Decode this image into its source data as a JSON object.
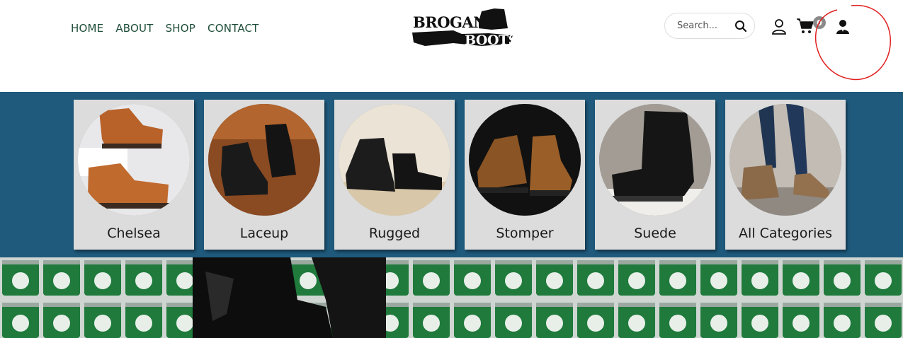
{
  "nav": {
    "items": [
      {
        "label": "HOME"
      },
      {
        "label": "ABOUT"
      },
      {
        "label": "SHOP"
      },
      {
        "label": "CONTACT"
      }
    ]
  },
  "logo": {
    "line1": "BROGAN",
    "line2": "BOOTS"
  },
  "search": {
    "placeholder": "Search..."
  },
  "cart": {
    "count": "0"
  },
  "categories": [
    {
      "label": "Chelsea"
    },
    {
      "label": "Laceup"
    },
    {
      "label": "Rugged"
    },
    {
      "label": "Stomper"
    },
    {
      "label": "Suede"
    },
    {
      "label": "All Categories"
    }
  ],
  "colors": {
    "nav_text": "#1e4d3a",
    "band": "#1f5a7d",
    "card": "#dcdcdc",
    "annotation": "#e02020"
  }
}
